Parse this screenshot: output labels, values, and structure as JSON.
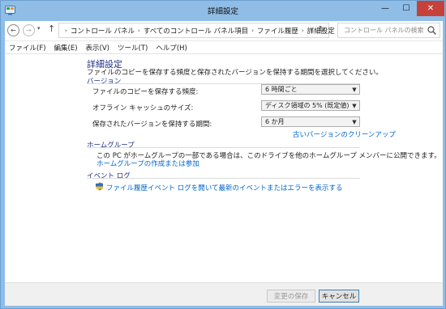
{
  "window": {
    "title": "詳細設定",
    "controls": {
      "minimize": "—",
      "maximize": "☐",
      "close": "✕"
    }
  },
  "nav": {
    "back": "←",
    "forward": "→",
    "up": "↑",
    "breadcrumbs": [
      "コントロール パネル",
      "すべてのコントロール パネル項目",
      "ファイル履歴",
      "詳細設定"
    ],
    "search_placeholder": "コントロール パネルの検索"
  },
  "menu": [
    "ファイル(F)",
    "編集(E)",
    "表示(V)",
    "ツール(T)",
    "ヘルプ(H)"
  ],
  "main": {
    "title": "詳細設定",
    "description": "ファイルのコピーを保存する頻度と保存されたバージョンを保持する期間を選択してください。",
    "versions": {
      "heading": "バージョン",
      "rows": [
        {
          "label": "ファイルのコピーを保存する頻度:",
          "value": "6 時間ごと"
        },
        {
          "label": "オフライン キャッシュのサイズ:",
          "value": "ディスク領域の 5% (既定値)"
        },
        {
          "label": "保存されたバージョンを保持する期間:",
          "value": "6 か月"
        }
      ],
      "cleanup_link": "古いバージョンのクリーンアップ"
    },
    "homegroup": {
      "heading": "ホームグループ",
      "text": "この PC がホームグループの一部である場合は、このドライブを他のホームグループ メンバーに公開できます。",
      "link": "ホームグループの作成または参加"
    },
    "eventlog": {
      "heading": "イベント ログ",
      "link": "ファイル履歴イベント ログを開いて最新のイベントまたはエラーを表示する"
    }
  },
  "footer": {
    "save": "変更の保存",
    "cancel": "キャンセル"
  },
  "colors": {
    "frame": "#8fbde6",
    "heading": "#1e3287",
    "link": "#0066cc",
    "close_button": "#c7413b"
  }
}
